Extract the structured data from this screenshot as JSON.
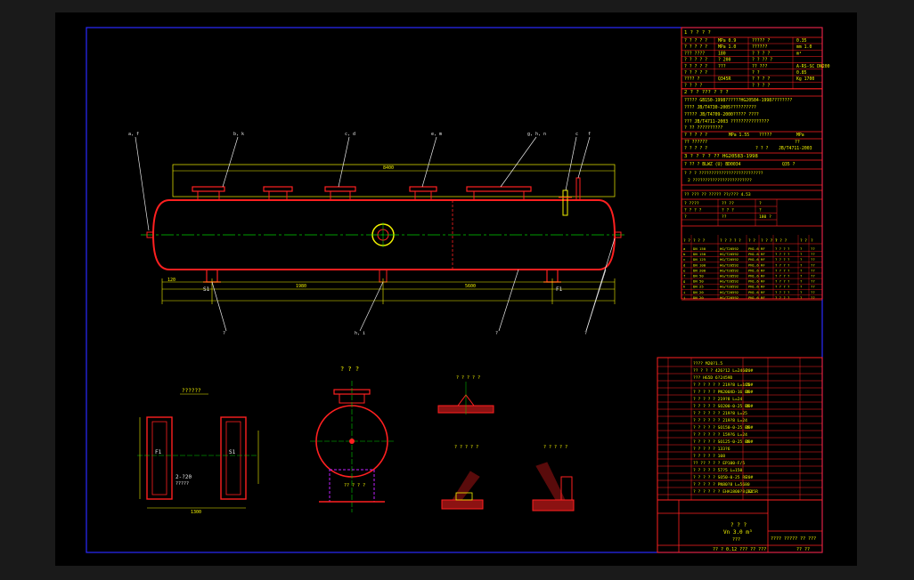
{
  "colors": {
    "background": "#000000",
    "frame": "#2a2aff",
    "table_lines": "#ff2020",
    "vessel": "#ff2020",
    "dimensions": "#f2f200",
    "centerlines": "#00d000",
    "text": "#f2f200",
    "callout": "#e8e8e8"
  },
  "title_block": {
    "section1": "1 ? ? ? ?",
    "specs": [
      [
        "? ? ? ? ?",
        "MPa  0.9",
        "????? ?",
        "0.35"
      ],
      [
        "? ? ? ? ?",
        "MPa  1.0",
        "??????",
        "mm  1.0"
      ],
      [
        "??? ????",
        "180",
        "? ? ? ?",
        "m³"
      ],
      [
        "? ? ? ? ?",
        "? 200",
        "? ? ?? ?",
        ""
      ],
      [
        "? ? ? ? ?",
        "???",
        "?? ???",
        "A-RS-SC DN200"
      ],
      [
        "? ? ? ? ?",
        "",
        "? ?",
        "0.85"
      ],
      [
        "???? ?",
        "Q345R",
        "? ? ? ?",
        "Kg   1700"
      ],
      [
        "? ? ? ?",
        "",
        "? ? ? ?",
        ""
      ]
    ],
    "section2": "2 ? ? ??? ? ? ?",
    "standards": [
      "????? GB150-1998??????HG20584-1998????????",
      "???? JB/T4730-2005??????????",
      "????? JB/T4709-2000????? ????",
      "??? JB/T4711-2003 ???????????????",
      "? ?? ??????????"
    ],
    "test": [
      "? ? ? ? ?",
      "MPa  1.55",
      "?????",
      "MPa",
      "?? ??????",
      "??",
      "? ? ? ? ?",
      "? ? ?",
      "JB/T4711-2003"
    ],
    "section3": "3 ? ? ? ?   ?? HG20583-1998",
    "coating": [
      "? ?? ? BLWZ (U) BD0034",
      "Q35 ?"
    ],
    "notes": [
      "? ? ? ??????????????????????????",
      "2  ????????????????????????"
    ],
    "anchor_rows": [
      [
        "? ????",
        "?? ??",
        "?"
      ],
      [
        "? ? ? ?",
        "? ? ?",
        "?"
      ],
      [
        "?",
        "??",
        "180 ?"
      ]
    ],
    "anchor_title": "?? ??? ?? ????? ??/??? 4.53",
    "nozzle_header": [
      "? ?",
      "? ? ?",
      "? ? ? ? ?",
      "? ?",
      "? ? ? ?",
      "? ? ?",
      "? ?",
      "?"
    ],
    "nozzles": [
      [
        "a",
        "DN 150",
        "HG/T20592",
        "PN1.6",
        "RF",
        "? ? ? ?",
        "?",
        "??"
      ],
      [
        "b",
        "DN 150",
        "HG/T20592",
        "PN1.6",
        "RF",
        "? ? ? ?",
        "?",
        "??"
      ],
      [
        "c",
        "DN 125",
        "HG/T20592",
        "PN1.6",
        "RF",
        "? ? ? ?",
        "?",
        "??"
      ],
      [
        "d",
        "DN 100",
        "HG/T20592",
        "PN1.6",
        "RF",
        "? ? ? ?",
        "?",
        "??"
      ],
      [
        "e",
        "DN 200",
        "HG/T20592",
        "PN1.6",
        "RF",
        "? ? ? ?",
        "?",
        "??"
      ],
      [
        "f",
        "DN 50",
        "HG/T20592",
        "PN1.6",
        "RF",
        "? ? ? ?",
        "?",
        "??"
      ],
      [
        "g",
        "DN 50",
        "HG/T20592",
        "PN1.6",
        "RF",
        "? ? ? ?",
        "?",
        "??"
      ],
      [
        "h",
        "DN 25",
        "HG/T20592",
        "PN1.6",
        "RF",
        "? ? ? ?",
        "?",
        "??"
      ],
      [
        "i",
        "DN 20",
        "HG/T20592",
        "PN1.6",
        "RF",
        "? ? ? ?",
        "?",
        "??"
      ],
      [
        "j",
        "DN 20",
        "HG/T20592",
        "PN1.6",
        "RF",
        "? ? ? ?",
        "?",
        "??"
      ]
    ]
  },
  "bom": [
    [
      "",
      "",
      "???? M20?1.5",
      "",
      "",
      "",
      ""
    ],
    [
      "",
      "",
      "?? ? ? ? 426?12 L=2460",
      "",
      "20#",
      "",
      ""
    ],
    [
      "",
      "",
      "??? HG5D 6?2459D",
      "",
      "",
      "",
      ""
    ],
    [
      "",
      "",
      "? ? ? ? ?  ? 219?8 L=165",
      "",
      "20#",
      "",
      ""
    ],
    [
      "",
      "",
      "? ? ? ? ?  PN200XD-16 RF",
      "",
      "20#",
      "",
      ""
    ],
    [
      "",
      "",
      "? ? ? ?  ? 219?8 L=24",
      "",
      "",
      "",
      ""
    ],
    [
      "",
      "",
      "? ? ? ? ?  SO200-0-25 RF",
      "",
      "20#",
      "",
      ""
    ],
    [
      "",
      "",
      "? ? ? ? ?  ? 219?8 L=25",
      "",
      "",
      "",
      ""
    ],
    [
      "",
      "",
      "? ? ? ? ?  ? 219?8 L=24",
      "",
      "",
      "",
      ""
    ],
    [
      "",
      "",
      "? ? ? ? ?  SO150-0-25 RF",
      "",
      "20#",
      "",
      ""
    ],
    [
      "",
      "",
      "? ? ? ? ?  ? 159?6 L=24",
      "",
      "",
      "",
      ""
    ],
    [
      "",
      "",
      "? ? ? ? ?  SO125-0-25 RF",
      "",
      "20#",
      "",
      ""
    ],
    [
      "",
      "",
      "? ? ? ?  ? 133?6",
      "",
      "",
      "",
      ""
    ],
    [
      "",
      "",
      "? ? ? ?  ? 108",
      "",
      "",
      "",
      ""
    ],
    [
      "",
      "",
      "?? ?? ? ? ?  EP100-F/5",
      "",
      "",
      "",
      ""
    ],
    [
      "",
      "",
      "? ? ? ?  ? 57?5 L=150",
      "",
      "",
      "",
      ""
    ],
    [
      "",
      "",
      "? ? ? ? ?  SO50-0-25 RF",
      "",
      "20#",
      "",
      ""
    ],
    [
      "",
      "",
      "? ? ? ? ?  PN80?8 L=5680",
      "",
      "",
      "",
      ""
    ],
    [
      "",
      "",
      "? ? ? ? ? ?  EHA1800?8,12",
      "",
      "Q345R",
      "",
      ""
    ]
  ],
  "title": {
    "line1": "? ? ?",
    "line2": "Vn  3.0  m³",
    "line3": "???",
    "drawing_no": "???? ????? ?? ???",
    "org": "?? ? 0.12 ??? ?? ???",
    "sheet": "?? ??"
  },
  "details": {
    "support": "??????",
    "side_view": "? ? ?",
    "weld1": "? ? ? ? ?",
    "weld2": "? ? ? ? ?",
    "weld3": "? ? ? ? ?"
  },
  "callouts": [
    "a, f",
    "b, k",
    "c, d",
    "e, m",
    "g, h, n",
    "c",
    "f",
    "?",
    "h, i",
    "?",
    "?",
    "?"
  ],
  "dims": [
    "8400",
    "120",
    "1980",
    "5600",
    "350",
    "2-?20"
  ],
  "labels": {
    "saddle_left": "F1",
    "saddle_right": "S1",
    "slot": "2-?20",
    "slot_note": "?????",
    "dim_saddle": "1300",
    "hole_spacing": "? ? ? ? ?",
    "side_tag": "?? ? ? ?"
  }
}
